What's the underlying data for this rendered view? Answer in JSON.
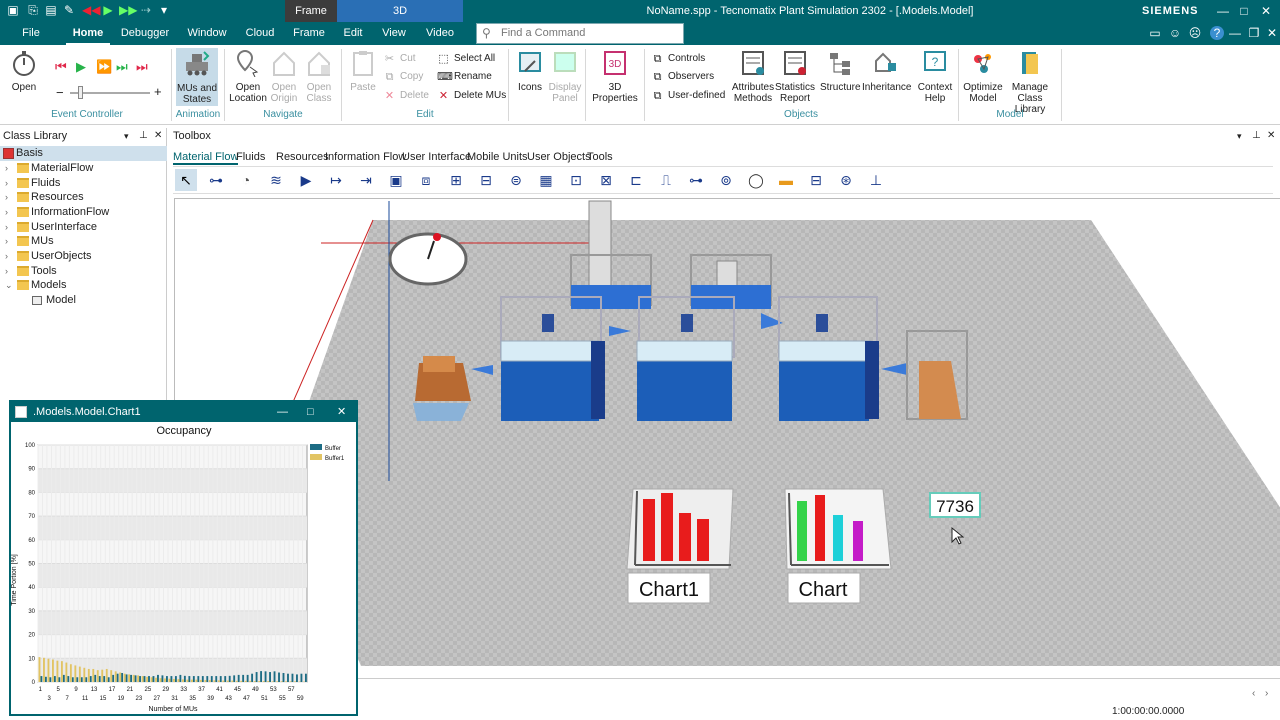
{
  "title": "NoName.spp - Tecnomatix Plant Simulation 2302 - [.Models.Model]",
  "brand": "SIEMENS",
  "context_headers": [
    "Frame",
    "3D"
  ],
  "menu": [
    "File",
    "Home",
    "Debugger",
    "Window",
    "Cloud",
    "Frame",
    "Edit",
    "View",
    "Video"
  ],
  "search_placeholder": "Find a Command",
  "ribbon": {
    "open": "Open",
    "event_controller": "Event Controller",
    "mus_states": "MUs and States",
    "animation": "Animation",
    "open_location": "Open Location",
    "open_origin": "Open Origin",
    "open_class": "Open Class",
    "navigate": "Navigate",
    "paste": "Paste",
    "cut": "Cut",
    "copy": "Copy",
    "delete": "Delete",
    "select_all": "Select All",
    "rename": "Rename",
    "delete_mus": "Delete MUs",
    "edit": "Edit",
    "icons": "Icons",
    "display_panel": "Display Panel",
    "properties_3d": "3D Properties",
    "controls": "Controls",
    "observers": "Observers",
    "user_defined": "User-defined",
    "attributes_methods": "Attributes Methods",
    "statistics_report": "Statistics Report",
    "structure": "Structure",
    "inheritance": "Inheritance",
    "context_help": "Context Help",
    "objects": "Objects",
    "optimize_model": "Optimize Model",
    "manage_class_library": "Manage Class Library",
    "model": "Model"
  },
  "class_library": {
    "title": "Class Library",
    "root": "Basis",
    "items": [
      "MaterialFlow",
      "Fluids",
      "Resources",
      "InformationFlow",
      "UserInterface",
      "MUs",
      "UserObjects",
      "Tools",
      "Models"
    ],
    "model_child": "Model"
  },
  "toolbox": {
    "title": "Toolbox",
    "tabs": [
      "Material Flow",
      "Fluids",
      "Resources",
      "Information Flow",
      "User Interface",
      "Mobile Units",
      "User Objects",
      "Tools"
    ]
  },
  "canvas": {
    "chart1_label": "Chart1",
    "chart_label": "Chart",
    "display_value": "7736"
  },
  "status_time": "1:00:00:00.0000",
  "chart_window": {
    "title": ".Models.Model.Chart1"
  },
  "chart_data": {
    "type": "bar",
    "title": "Occupancy",
    "xlabel": "Number of MUs",
    "ylabel": "Time Portion [%]",
    "ylim": [
      0,
      100
    ],
    "yticks": [
      0,
      10,
      20,
      30,
      40,
      50,
      60,
      70,
      80,
      90,
      100
    ],
    "xticks_top": [
      "1",
      "5",
      "9",
      "13",
      "17",
      "21",
      "25",
      "29",
      "33",
      "37",
      "41",
      "45",
      "49",
      "53",
      "57"
    ],
    "xticks_bottom": [
      "3",
      "7",
      "11",
      "15",
      "19",
      "23",
      "27",
      "31",
      "35",
      "39",
      "43",
      "47",
      "51",
      "55",
      "59"
    ],
    "legend": "top-right",
    "colors": {
      "Buffer": "#1d6c84",
      "Buffer1": "#e2c463"
    },
    "series": [
      {
        "name": "Buffer",
        "values": [
          2.5,
          2.2,
          2,
          2.5,
          2,
          3,
          2.5,
          2,
          2,
          2,
          2,
          2.5,
          3,
          2.5,
          2.5,
          2,
          3,
          3.5,
          3.8,
          3.2,
          3,
          2.8,
          2.5,
          2.5,
          2.5,
          2.5,
          3,
          2.8,
          2.5,
          2.5,
          2.5,
          3,
          2.6,
          2.5,
          2.5,
          2.5,
          2.5,
          2.5,
          2.5,
          2.5,
          2.5,
          2.5,
          2.6,
          2.8,
          3,
          3,
          3,
          3.5,
          4.2,
          4.6,
          4.5,
          4.2,
          4.5,
          4,
          3.8,
          3.5,
          3.5,
          3.2,
          3.5,
          3.5
        ]
      },
      {
        "name": "Buffer1",
        "values": [
          10.5,
          10.2,
          9.8,
          9.5,
          9,
          8.8,
          8.2,
          7.5,
          7,
          6.5,
          6,
          5.5,
          5.5,
          5,
          5.2,
          5.5,
          5,
          4.5,
          4,
          3.5,
          3.2,
          3,
          2.8,
          2.5,
          2.2,
          2,
          1.8,
          1.6,
          1.5,
          1.4,
          1.3,
          1.2,
          1.1,
          1,
          1,
          1,
          0.9,
          0.8,
          0.8,
          0.7,
          0.7,
          0.6,
          0.6,
          0.6,
          0.5,
          0.5,
          0.5,
          0.5,
          0.4,
          0.4,
          0.4,
          0.4,
          0.3,
          0.3,
          0.3,
          0.3,
          0.3,
          0.3,
          0.2,
          0.2
        ]
      }
    ]
  }
}
